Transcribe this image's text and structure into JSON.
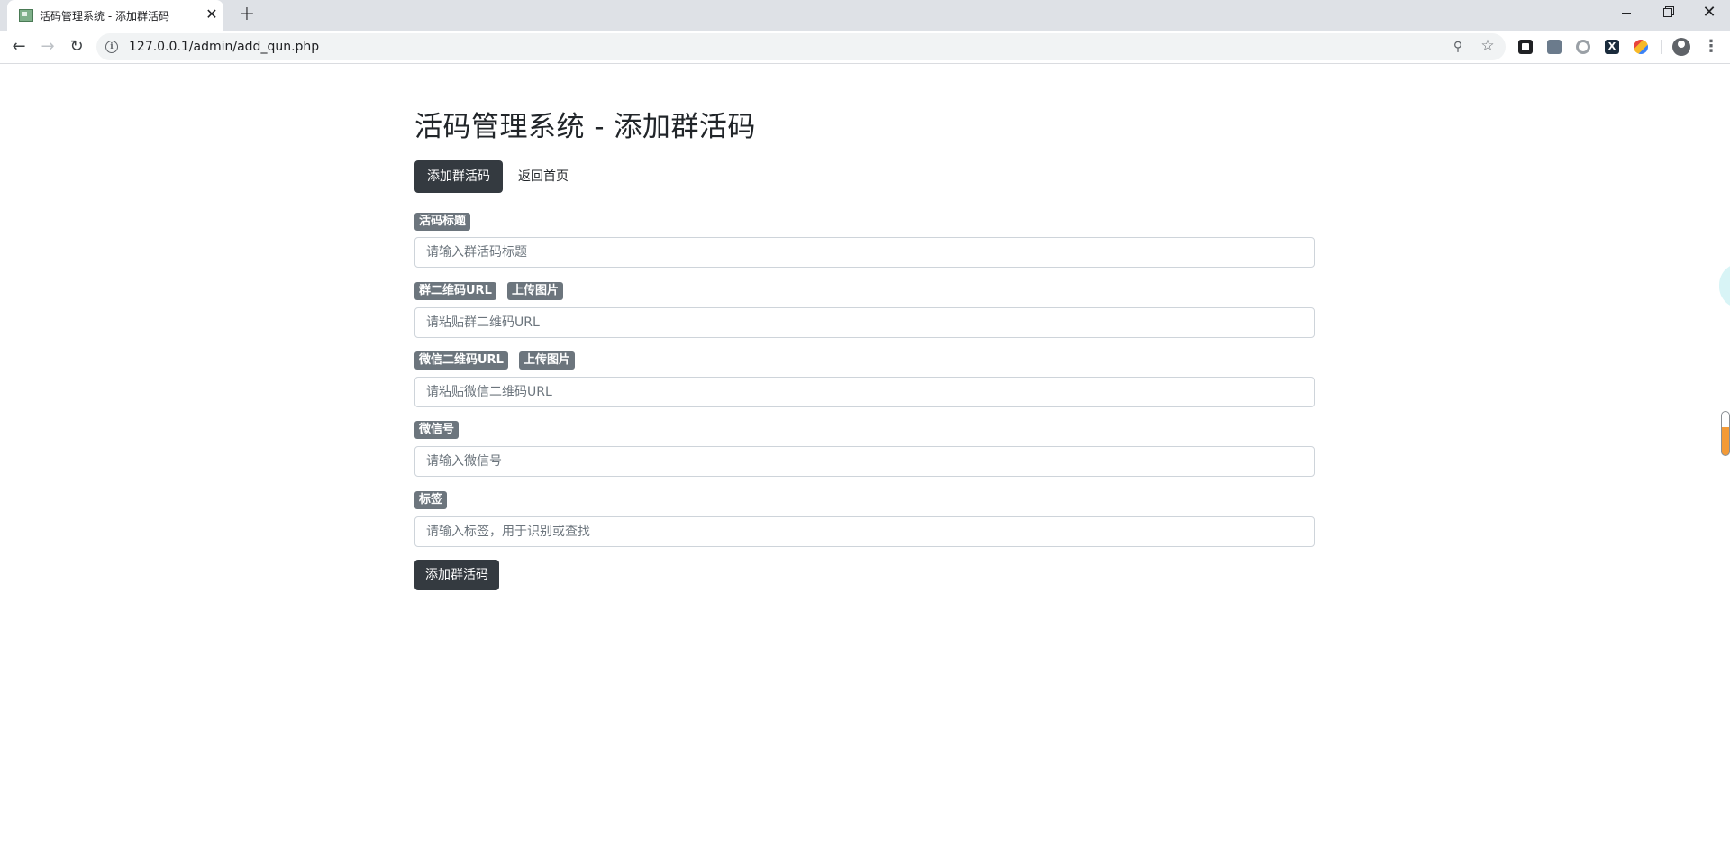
{
  "browser": {
    "tab_title": "活码管理系统 - 添加群活码",
    "tab_close": "✕",
    "new_tab": "+",
    "url": "127.0.0.1/admin/add_qun.php",
    "extension_x_label": "X"
  },
  "page": {
    "title": "活码管理系统 - 添加群活码",
    "nav": {
      "add_button": "添加群活码",
      "home_link": "返回首页"
    },
    "form": {
      "title_field": {
        "label": "活码标题",
        "placeholder": "请输入群活码标题"
      },
      "group_qr_field": {
        "label": "群二维码URL",
        "upload_label": "上传图片",
        "placeholder": "请粘贴群二维码URL"
      },
      "wechat_qr_field": {
        "label": "微信二维码URL",
        "upload_label": "上传图片",
        "placeholder": "请粘贴微信二维码URL"
      },
      "wechat_id_field": {
        "label": "微信号",
        "placeholder": "请输入微信号"
      },
      "tag_field": {
        "label": "标签",
        "placeholder": "请输入标签，用于识别或查找"
      },
      "submit_label": "添加群活码"
    }
  },
  "colors": {
    "primary_dark": "#343a40",
    "badge_gray": "#6c757d",
    "input_border": "#ced4da",
    "chrome_tabstrip": "#dee1e6"
  }
}
